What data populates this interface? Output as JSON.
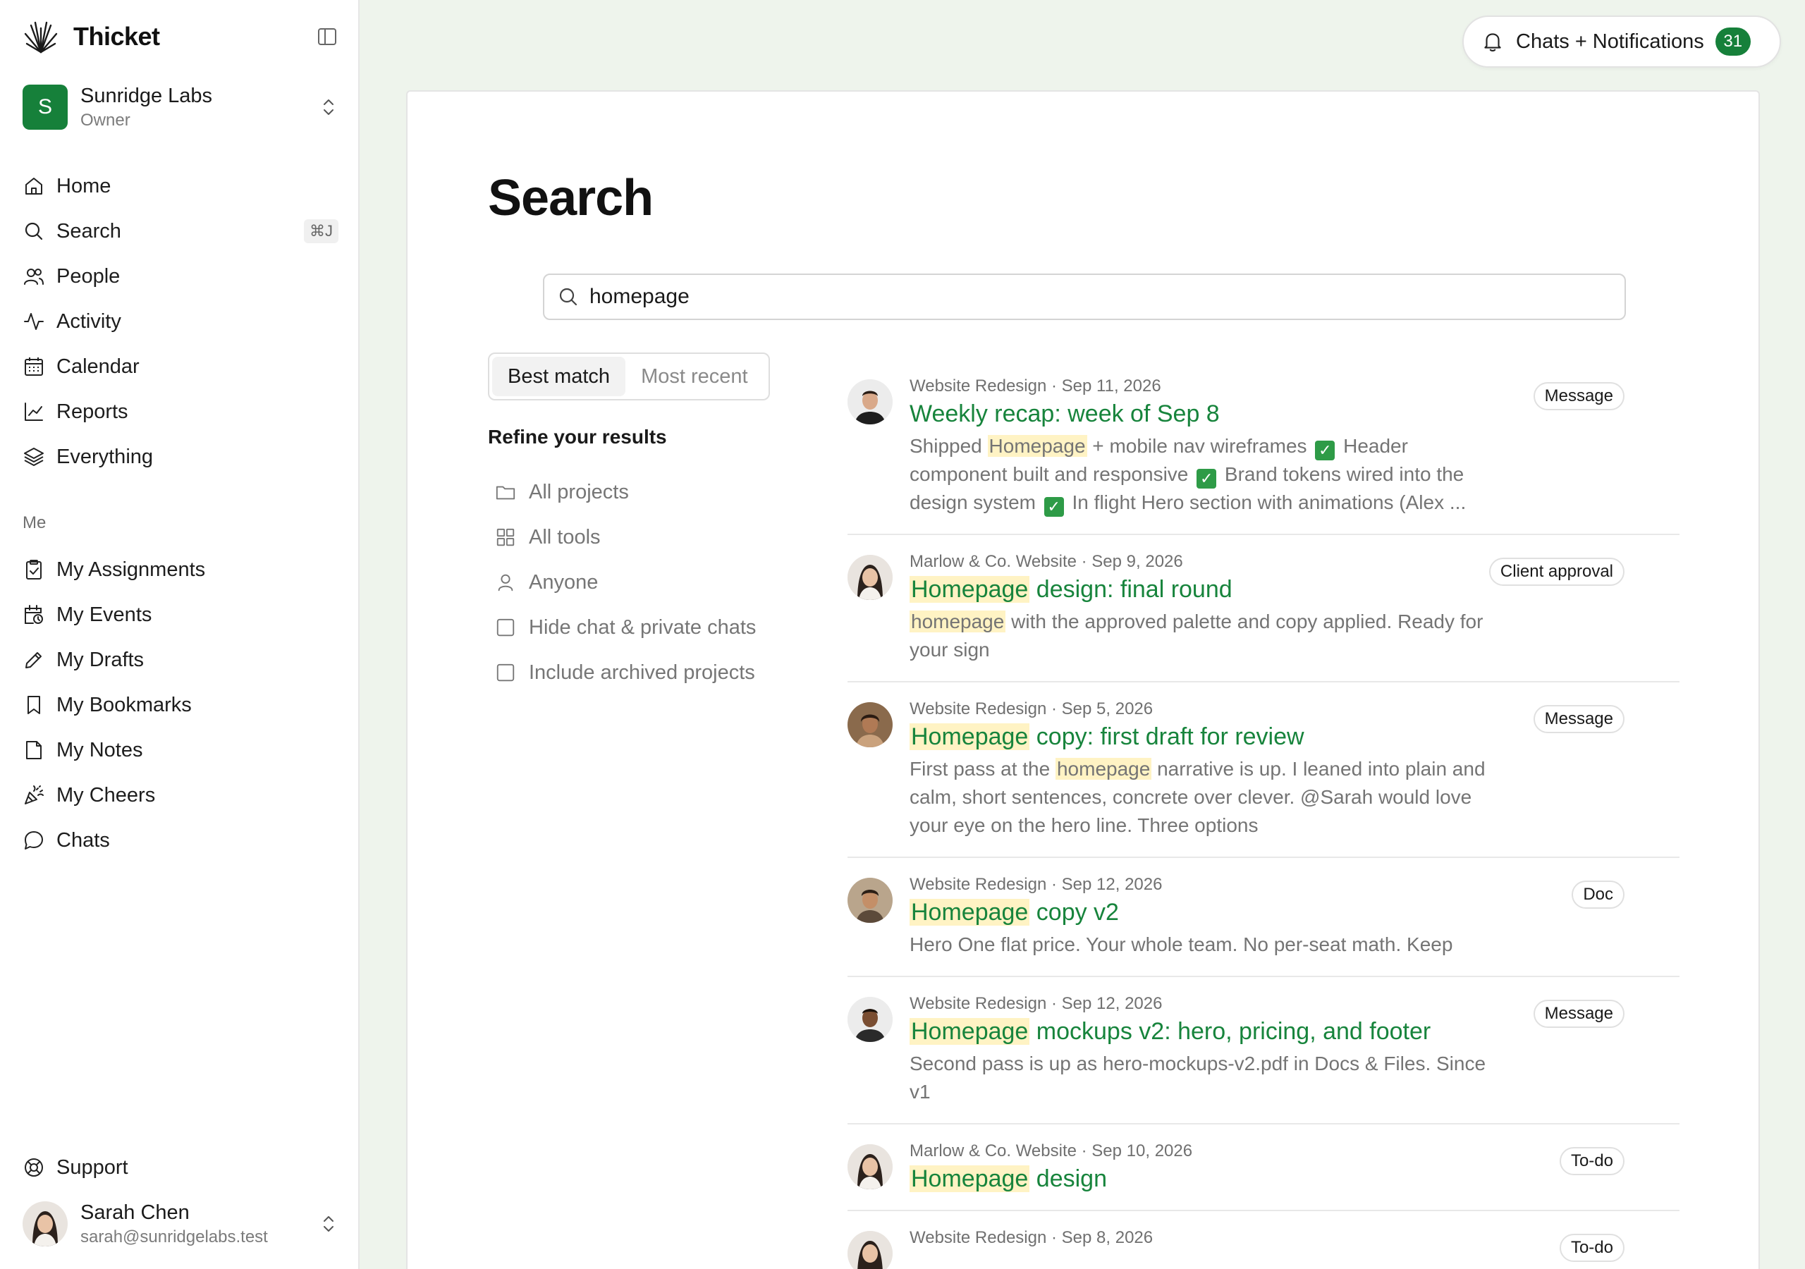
{
  "app": {
    "name": "Thicket"
  },
  "workspace": {
    "initial": "S",
    "name": "Sunridge Labs",
    "role": "Owner",
    "color": "#16803a"
  },
  "nav": {
    "items": [
      {
        "label": "Home",
        "icon": "home-icon"
      },
      {
        "label": "Search",
        "icon": "search-icon",
        "shortcut": "⌘J"
      },
      {
        "label": "People",
        "icon": "people-icon"
      },
      {
        "label": "Activity",
        "icon": "activity-icon"
      },
      {
        "label": "Calendar",
        "icon": "calendar-icon"
      },
      {
        "label": "Reports",
        "icon": "reports-icon"
      },
      {
        "label": "Everything",
        "icon": "layers-icon"
      }
    ],
    "me_label": "Me",
    "me_items": [
      {
        "label": "My Assignments",
        "icon": "clipboard-check-icon"
      },
      {
        "label": "My Events",
        "icon": "calendar-clock-icon"
      },
      {
        "label": "My Drafts",
        "icon": "pencil-icon"
      },
      {
        "label": "My Bookmarks",
        "icon": "bookmark-icon"
      },
      {
        "label": "My Notes",
        "icon": "note-icon"
      },
      {
        "label": "My Cheers",
        "icon": "party-popper-icon"
      },
      {
        "label": "Chats",
        "icon": "chat-bubble-icon"
      }
    ],
    "support": "Support"
  },
  "user": {
    "name": "Sarah Chen",
    "email": "sarah@sunridgelabs.test"
  },
  "notifications": {
    "label": "Chats + Notifications",
    "count": "31"
  },
  "page": {
    "title": "Search"
  },
  "search": {
    "value": "homepage"
  },
  "sort": {
    "tabs": [
      "Best match",
      "Most recent"
    ],
    "active": "Best match"
  },
  "refine": {
    "title": "Refine your results",
    "filters": [
      {
        "label": "All projects",
        "icon": "folder-icon"
      },
      {
        "label": "All tools",
        "icon": "grid-icon"
      },
      {
        "label": "Anyone",
        "icon": "person-icon"
      },
      {
        "label": "Hide chat & private chats",
        "icon": "checkbox-icon",
        "checked": false
      },
      {
        "label": "Include archived projects",
        "icon": "checkbox-icon",
        "checked": false
      }
    ]
  },
  "results": [
    {
      "meta": "Website Redesign · Sep 11, 2026",
      "title": "Weekly recap: week of Sep 8",
      "badge": "Message",
      "snippet": "Shipped Homepage + mobile nav wireframes ✅ Header component built and responsive ✅ Brand tokens wired into the design system ✅ In flight Hero section with animations (Alex ..."
    },
    {
      "meta": "Marlow & Co. Website · Sep 9, 2026",
      "title": "Homepage design: final round",
      "badge": "Client approval",
      "snippet": "homepage with the approved palette and copy applied. Ready for your sign"
    },
    {
      "meta": "Website Redesign · Sep 5, 2026",
      "title": "Homepage copy: first draft for review",
      "badge": "Message",
      "snippet": "First pass at the homepage narrative is up. I leaned into plain and calm, short sentences, concrete over clever. @Sarah would love your eye on the hero line. Three options"
    },
    {
      "meta": "Website Redesign · Sep 12, 2026",
      "title": "Homepage copy v2",
      "badge": "Doc",
      "snippet": "Hero One flat price. Your whole team. No per-seat math. Keep"
    },
    {
      "meta": "Website Redesign · Sep 12, 2026",
      "title": "Homepage mockups v2: hero, pricing, and footer",
      "badge": "Message",
      "snippet": "Second pass is up as hero-mockups-v2.pdf in Docs & Files. Since v1"
    },
    {
      "meta": "Marlow & Co. Website · Sep 10, 2026",
      "title": "Homepage design",
      "badge": "To-do",
      "snippet": ""
    },
    {
      "meta": "Website Redesign · Sep 8, 2026",
      "title": "",
      "badge": "To-do",
      "snippet": ""
    }
  ],
  "highlight_term": "homepage",
  "colors": {
    "accent": "#16803a",
    "link": "#17843c",
    "highlight": "#fff3c4",
    "background": "#eef4ec"
  }
}
